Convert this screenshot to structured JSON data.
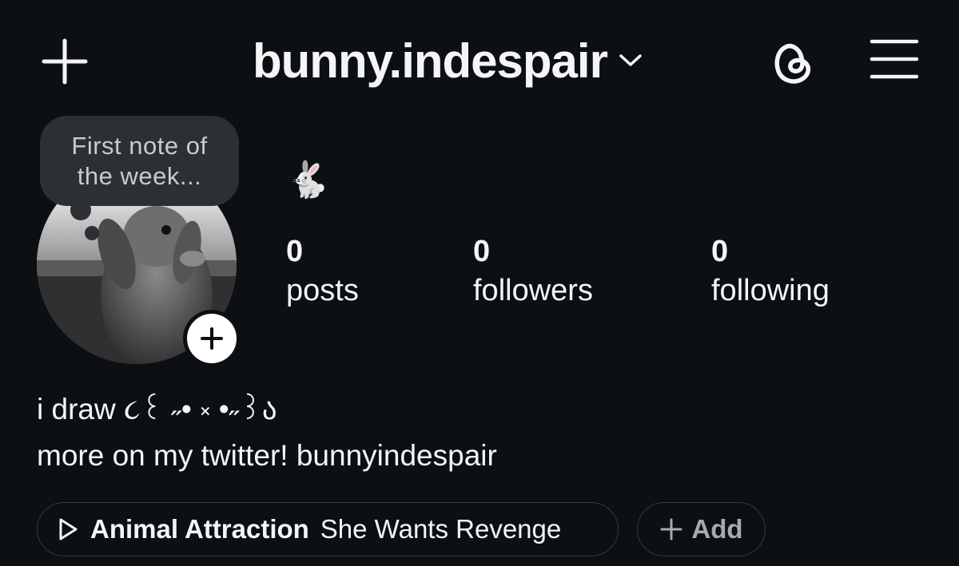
{
  "header": {
    "username": "bunny.indespair"
  },
  "profile": {
    "note": "First note of the week...",
    "name_emoji": "🐇",
    "stats": [
      {
        "count": "0",
        "label": "posts"
      },
      {
        "count": "0",
        "label": "followers"
      },
      {
        "count": "0",
        "label": "following"
      }
    ],
    "bio": {
      "line1": "i draw ૮꒰ ˶• ༝ •˶꒱ა",
      "line2": "more on my twitter! bunnyindespair"
    }
  },
  "music": {
    "title": "Animal Attraction",
    "artist": "She Wants Revenge"
  },
  "add_button": {
    "label": "Add"
  },
  "icons": {
    "new_post": "plus-icon",
    "account_switch": "chevron-down-icon",
    "threads": "threads-icon",
    "menu": "hamburger-menu-icon",
    "add_story": "plus-icon",
    "music": "play-icon",
    "add": "plus-icon"
  }
}
